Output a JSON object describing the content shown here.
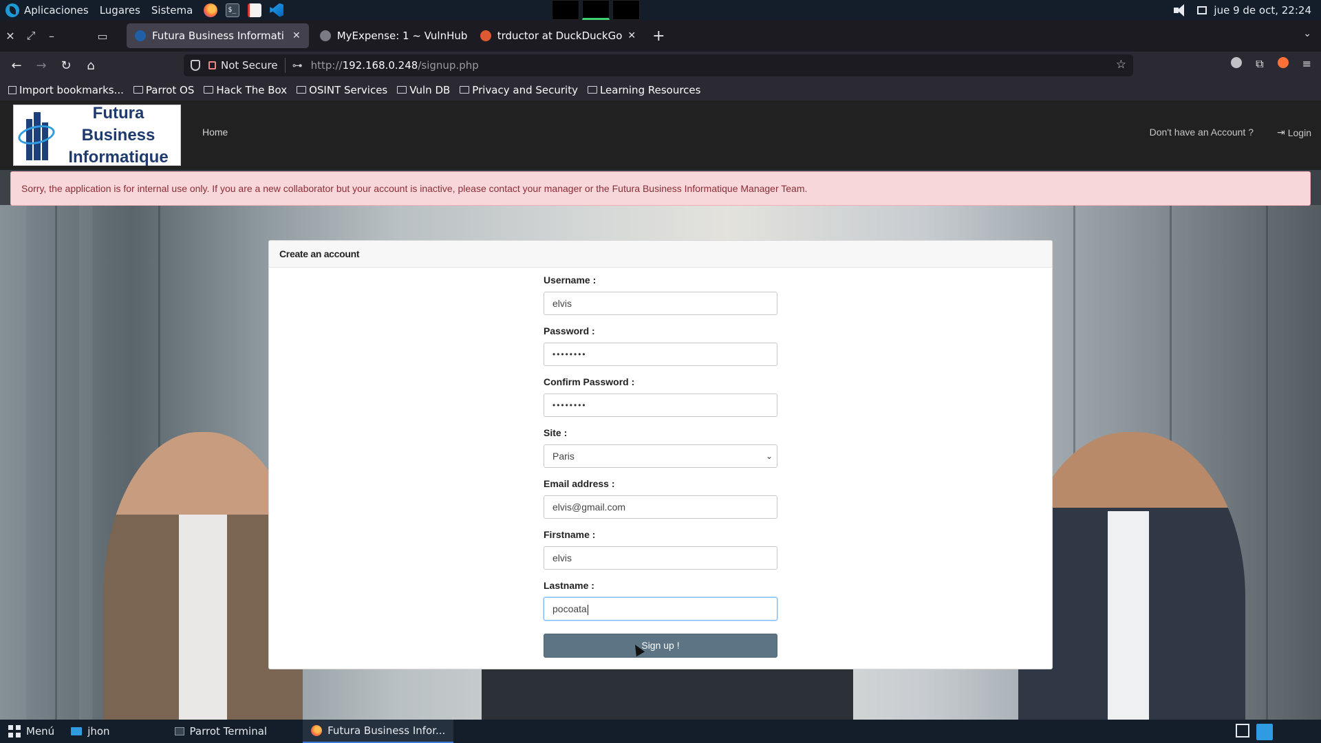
{
  "os": {
    "menus": [
      "Aplicaciones",
      "Lugares",
      "Sistema"
    ],
    "clock": "jue  9 de oct, 22:24"
  },
  "browser": {
    "tabs": [
      {
        "title": "Futura Business Informati",
        "active": true
      },
      {
        "title": "MyExpense: 1 ~ VulnHub",
        "active": false
      },
      {
        "title": "trductor at DuckDuckGo",
        "active": false
      }
    ],
    "security_label": "Not Secure",
    "url_prefix": "http://",
    "url_host": "192.168.0.248",
    "url_path": "/signup.php",
    "bookmarks": [
      "Import bookmarks...",
      "Parrot OS",
      "Hack The Box",
      "OSINT Services",
      "Vuln DB",
      "Privacy and Security",
      "Learning Resources"
    ]
  },
  "site": {
    "logo_line1": "Futura Business",
    "logo_line2": "Informatique",
    "nav_home": "Home",
    "nav_no_account": "Don't have an Account ?",
    "nav_login": "Login",
    "alert": "Sorry, the application is for internal use only. If you are a new collaborator but your account is inactive, please contact your manager or the Futura Business Informatique Manager Team."
  },
  "form": {
    "title": "Create an account",
    "username_label": "Username :",
    "username_value": "elvis",
    "password_label": "Password :",
    "password_value": "••••••••",
    "confirm_label": "Confirm Password :",
    "confirm_value": "••••••••",
    "site_label": "Site :",
    "site_value": "Paris",
    "email_label": "Email address :",
    "email_value": "elvis@gmail.com",
    "firstname_label": "Firstname :",
    "firstname_value": "elvis",
    "lastname_label": "Lastname :",
    "lastname_value": "pocoata",
    "submit_label": "Sign up !"
  },
  "taskbar": {
    "menu_label": "Menú",
    "items": [
      "jhon",
      "Parrot Terminal",
      "Futura Business Infor..."
    ]
  },
  "colors": {
    "alert_bg": "#f8d7da",
    "alert_text": "#8a2d35",
    "submit_bg": "#5c7484",
    "site_nav_bg": "#212121"
  }
}
